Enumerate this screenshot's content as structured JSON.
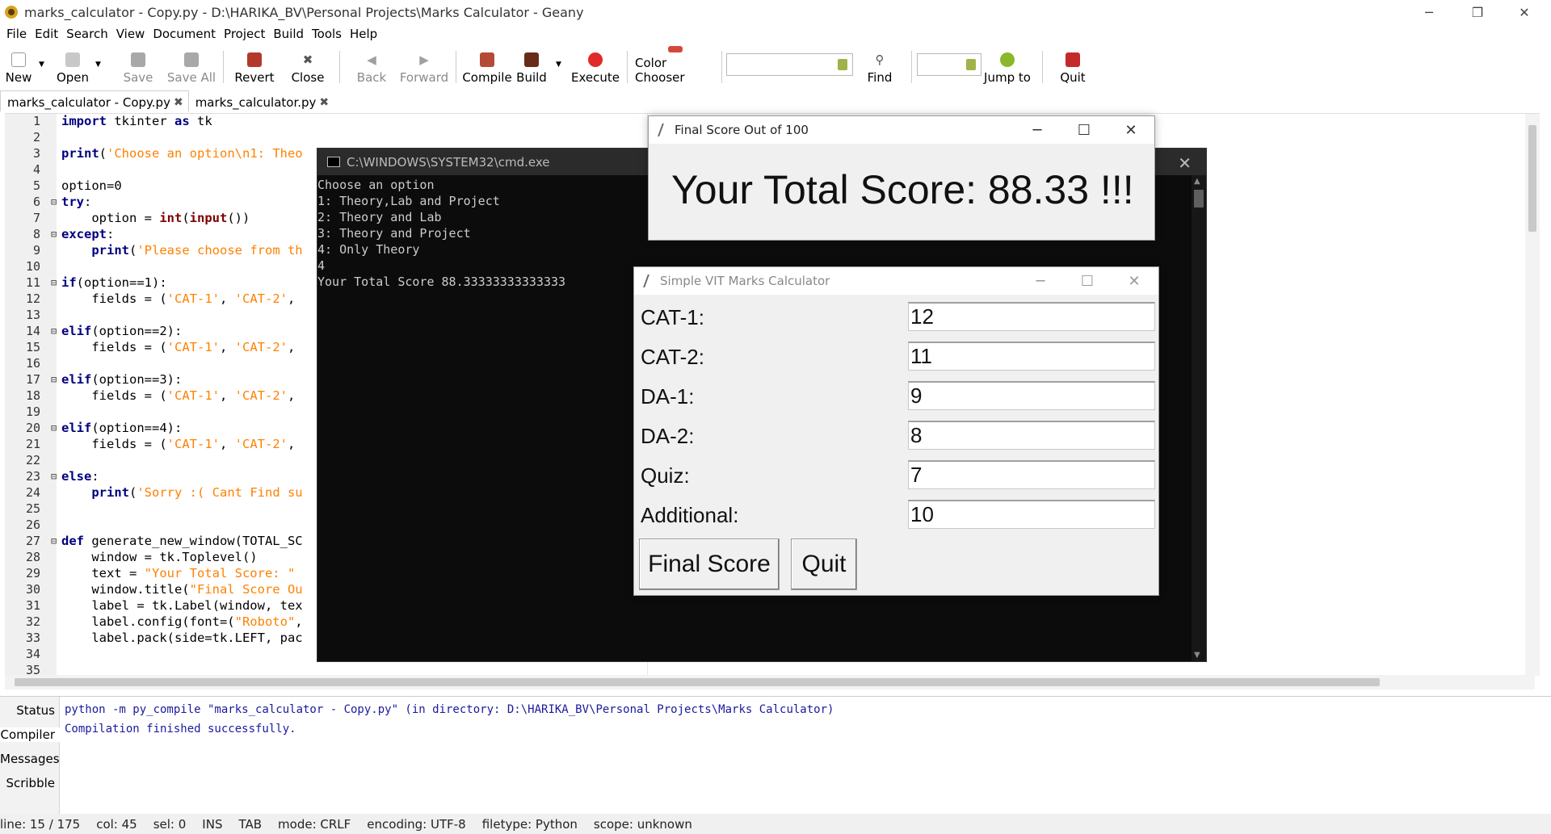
{
  "window": {
    "title": "marks_calculator - Copy.py - D:\\HARIKA_BV\\Personal Projects\\Marks Calculator - Geany",
    "minimize": "─",
    "restore": "❐",
    "close": "✕"
  },
  "menu": [
    "File",
    "Edit",
    "Search",
    "View",
    "Document",
    "Project",
    "Build",
    "Tools",
    "Help"
  ],
  "toolbar": {
    "new": "New",
    "open": "Open",
    "save": "Save",
    "save_all": "Save All",
    "revert": "Revert",
    "close": "Close",
    "back": "Back",
    "forward": "Forward",
    "compile": "Compile",
    "build": "Build",
    "execute": "Execute",
    "color_chooser": "Color Chooser",
    "find": "Find",
    "jump_to": "Jump to",
    "quit": "Quit"
  },
  "tabs": [
    {
      "label": "marks_calculator - Copy.py",
      "close": "✖"
    },
    {
      "label": "marks_calculator.py",
      "close": "✖"
    }
  ],
  "editor": {
    "line_numbers": [
      "1",
      "2",
      "3",
      "4",
      "5",
      "6",
      "7",
      "8",
      "9",
      "10",
      "11",
      "12",
      "13",
      "14",
      "15",
      "16",
      "17",
      "18",
      "19",
      "20",
      "21",
      "22",
      "23",
      "24",
      "25",
      "26",
      "27",
      "28",
      "29",
      "30",
      "31",
      "32",
      "33",
      "34",
      "35"
    ]
  },
  "cmd": {
    "title": "C:\\WINDOWS\\SYSTEM32\\cmd.exe",
    "close": "✕",
    "lines": [
      "Choose an option",
      "1: Theory,Lab and Project",
      "2: Theory and Lab",
      "3: Theory and Project",
      "4: Only Theory",
      "4",
      "Your Total Score 88.33333333333333"
    ]
  },
  "final_window": {
    "title": "Final Score Out of 100",
    "score_text": "Your Total Score: 88.33 !!!"
  },
  "calc_window": {
    "title": "Simple VIT Marks Calculator",
    "fields": [
      {
        "label": "CAT-1:",
        "value": "12"
      },
      {
        "label": "CAT-2:",
        "value": "11"
      },
      {
        "label": "DA-1:",
        "value": "9"
      },
      {
        "label": "DA-2:",
        "value": "8"
      },
      {
        "label": "Quiz:",
        "value": "7"
      },
      {
        "label": "Additional:",
        "value": "10"
      }
    ],
    "final_score_button": "Final Score",
    "quit_button": "Quit"
  },
  "messages": {
    "tabs": [
      "Status",
      "Compiler",
      "Messages",
      "Scribble"
    ],
    "lines": [
      "python -m py_compile \"marks_calculator - Copy.py\" (in directory: D:\\HARIKA_BV\\Personal Projects\\Marks Calculator)",
      "Compilation finished successfully."
    ]
  },
  "status": {
    "line": "line: 15 / 175",
    "col": "col: 45",
    "sel": "sel: 0",
    "ins": "INS",
    "tab": "TAB",
    "mode": "mode: CRLF",
    "encoding": "encoding: UTF-8",
    "filetype": "filetype: Python",
    "scope": "scope: unknown"
  }
}
